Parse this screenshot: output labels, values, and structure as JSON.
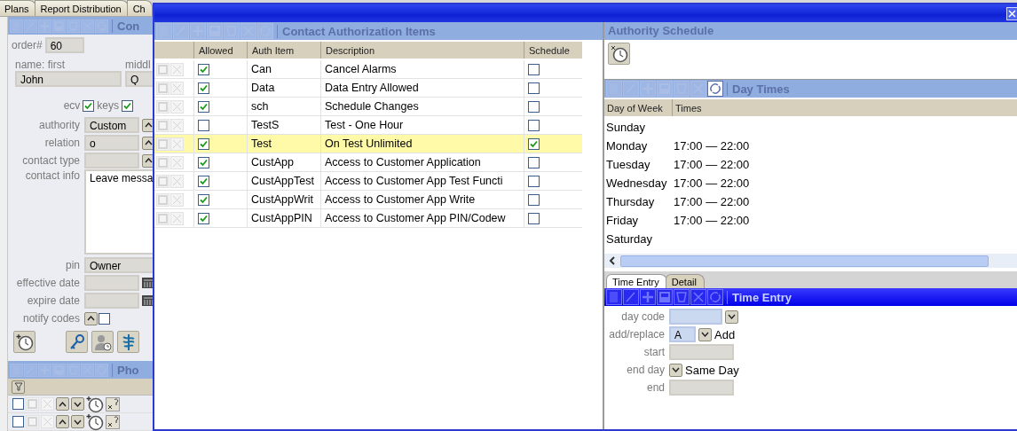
{
  "background": {
    "tabs": [
      {
        "label": "Plans",
        "selected": false
      },
      {
        "label": "Report Distribution",
        "selected": false
      },
      {
        "label": "Ch",
        "selected": false
      }
    ],
    "contact_panel": {
      "title": "Con",
      "order_label": "order#",
      "order": "60",
      "first_label": "name: first",
      "first": "John",
      "middle_label": "middl",
      "middle": "Q",
      "ecv": {
        "label": "ecv",
        "checked": true
      },
      "keys": {
        "label": "keys",
        "checked": true
      },
      "fields": [
        {
          "kind": "select",
          "label": "authority",
          "value": "Custom"
        },
        {
          "kind": "select",
          "label": "relation",
          "value": "o"
        },
        {
          "kind": "select",
          "label": "contact type"
        },
        {
          "kind": "textarea",
          "label": "contact info",
          "value": "Leave messa"
        },
        {
          "kind": "text",
          "label": "pin",
          "value": "Owner"
        },
        {
          "kind": "date",
          "label": "effective date"
        },
        {
          "kind": "date",
          "label": "expire date"
        },
        {
          "kind": "notify",
          "label": "notify codes",
          "checked": false
        }
      ]
    },
    "phone_panel": {
      "title": "Pho",
      "rows": [
        {
          "checked": false
        },
        {
          "checked": false
        }
      ]
    }
  },
  "dialog": {
    "auth_items": {
      "title": "Contact Authorization Items",
      "columns": [
        "Allowed",
        "Auth Item",
        "Description",
        "Schedule"
      ],
      "rows": [
        {
          "allowed": true,
          "item": "Can",
          "description": "Cancel Alarms",
          "schedule": false,
          "selected": false
        },
        {
          "allowed": true,
          "item": "Data",
          "description": "Data Entry Allowed",
          "schedule": false,
          "selected": false
        },
        {
          "allowed": true,
          "item": "sch",
          "description": "Schedule Changes",
          "schedule": false,
          "selected": false
        },
        {
          "allowed": false,
          "item": "TestS",
          "description": "Test - One Hour",
          "schedule": false,
          "selected": false
        },
        {
          "allowed": true,
          "item": "Test",
          "description": "On Test Unlimited",
          "schedule": true,
          "selected": true
        },
        {
          "allowed": true,
          "item": "CustApp",
          "description": "Access to Customer Application",
          "schedule": false,
          "selected": false
        },
        {
          "allowed": true,
          "item": "CustAppTest",
          "description": "Access to Customer App Test Functi",
          "schedule": false,
          "selected": false
        },
        {
          "allowed": true,
          "item": "CustAppWrit",
          "description": "Access to Customer App Write",
          "schedule": false,
          "selected": false
        },
        {
          "allowed": true,
          "item": "CustAppPIN",
          "description": "Access to Customer App PIN/Codew",
          "schedule": false,
          "selected": false
        }
      ]
    },
    "schedule": {
      "title": "Authority Schedule",
      "day_times": {
        "title": "Day Times",
        "columns": [
          "Day of Week",
          "Times"
        ],
        "rows": [
          {
            "day": "Sunday"
          },
          {
            "day": "Monday",
            "times": "17:00 — 22:00"
          },
          {
            "day": "Tuesday",
            "times": "17:00 — 22:00"
          },
          {
            "day": "Wednesday",
            "times": "17:00 — 22:00"
          },
          {
            "day": "Thursday",
            "times": "17:00 — 22:00"
          },
          {
            "day": "Friday",
            "times": "17:00 — 22:00"
          },
          {
            "day": "Saturday"
          }
        ]
      },
      "tabs": [
        {
          "label": "Time Entry",
          "selected": true
        },
        {
          "label": "Detail",
          "selected": false
        }
      ],
      "time_entry": {
        "title": "Time Entry",
        "fields": [
          {
            "kind": "select",
            "label": "day code"
          },
          {
            "kind": "code",
            "label": "add/replace",
            "value": "A",
            "text": "Add"
          },
          {
            "kind": "text",
            "label": "start"
          },
          {
            "kind": "choice",
            "label": "end day",
            "text": "Same Day"
          },
          {
            "kind": "text",
            "label": "end"
          }
        ]
      }
    }
  }
}
